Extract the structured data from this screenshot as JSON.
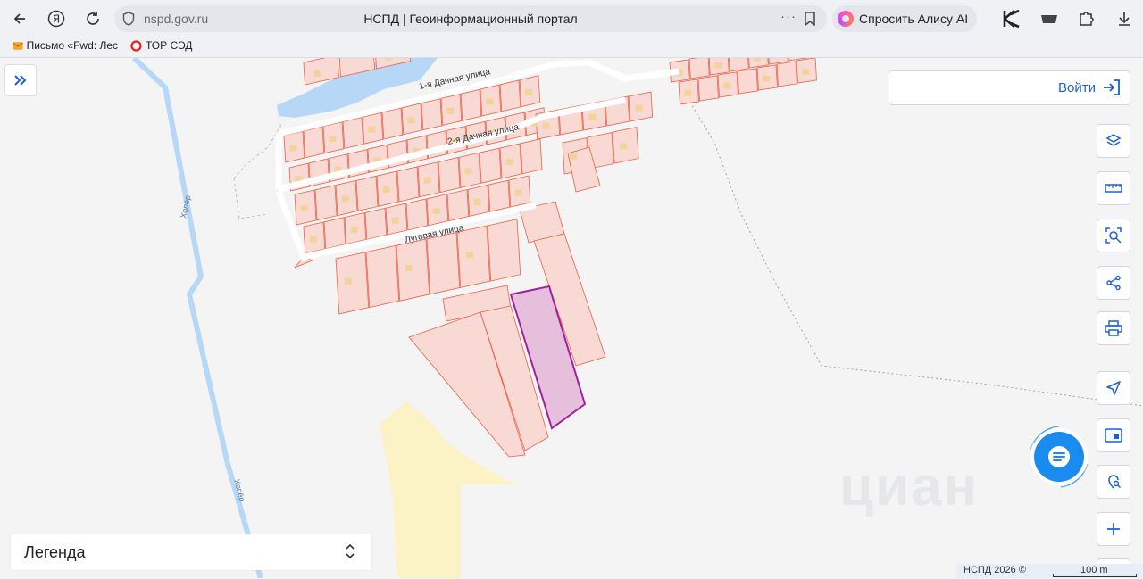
{
  "browser": {
    "url": "nspd.gov.ru",
    "page_title": "НСПД | Геоинформационный портал",
    "alice_label": "Спросить Алису AI",
    "more_label": "···"
  },
  "bookmarks": [
    {
      "label": "Письмо «Fwd: Лес"
    },
    {
      "label": "ТОР СЭД"
    }
  ],
  "map": {
    "street_labels": [
      "1-я Дачная улица",
      "2-я Дачная улица",
      "Луговая улица"
    ],
    "river_labels": [
      "Хопёр",
      "Хопёр"
    ],
    "watermark": "циан",
    "selected_parcel_color": "#a020a0",
    "parcel_stroke_color": "#e8624a",
    "parcel_fill_color": "#f8d9d3",
    "water_color": "#b7d7f7"
  },
  "overlays": {
    "login_label": "Войти",
    "legend_label": "Легенда",
    "attribution": "НСПД 2026 ©",
    "scale_label": "100 m"
  },
  "toolbar": {
    "icons": [
      "layers-icon",
      "ruler-icon",
      "area-search-icon",
      "share-icon",
      "print-icon",
      "navigate-icon",
      "map-window-icon",
      "location-search-icon",
      "zoom-in-icon"
    ]
  }
}
